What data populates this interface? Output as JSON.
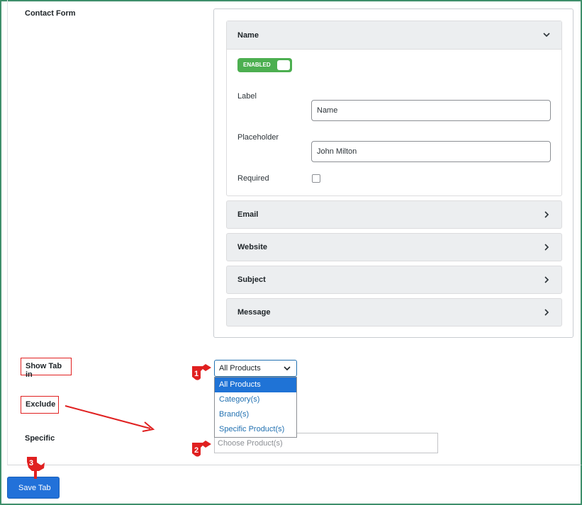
{
  "contact_form": {
    "section_label": "Contact Form",
    "fields_open": {
      "title": "Name",
      "toggle_label": "ENABLED",
      "label_label": "Label",
      "label_value": "Name",
      "placeholder_label": "Placeholder",
      "placeholder_value": "John Milton",
      "required_label": "Required",
      "required_checked": false
    },
    "fields_collapsed": [
      "Email",
      "Website",
      "Subject",
      "Message"
    ]
  },
  "show_tab_in": {
    "label": "Show Tab in",
    "selected": "All Products",
    "options": [
      "All Products",
      "Category(s)",
      "Brand(s)",
      "Specific Product(s)"
    ]
  },
  "exclude": {
    "label": "Exclude"
  },
  "specific": {
    "label": "Specific",
    "placeholder": "Choose Product(s)"
  },
  "save_button_label": "Save Tab",
  "annotations": {
    "markers": [
      "1",
      "2",
      "3"
    ],
    "color": "#e02020"
  },
  "colors": {
    "toggle_on": "#4caf50",
    "primary": "#2271d9",
    "selected_option": "#1f73d6"
  }
}
